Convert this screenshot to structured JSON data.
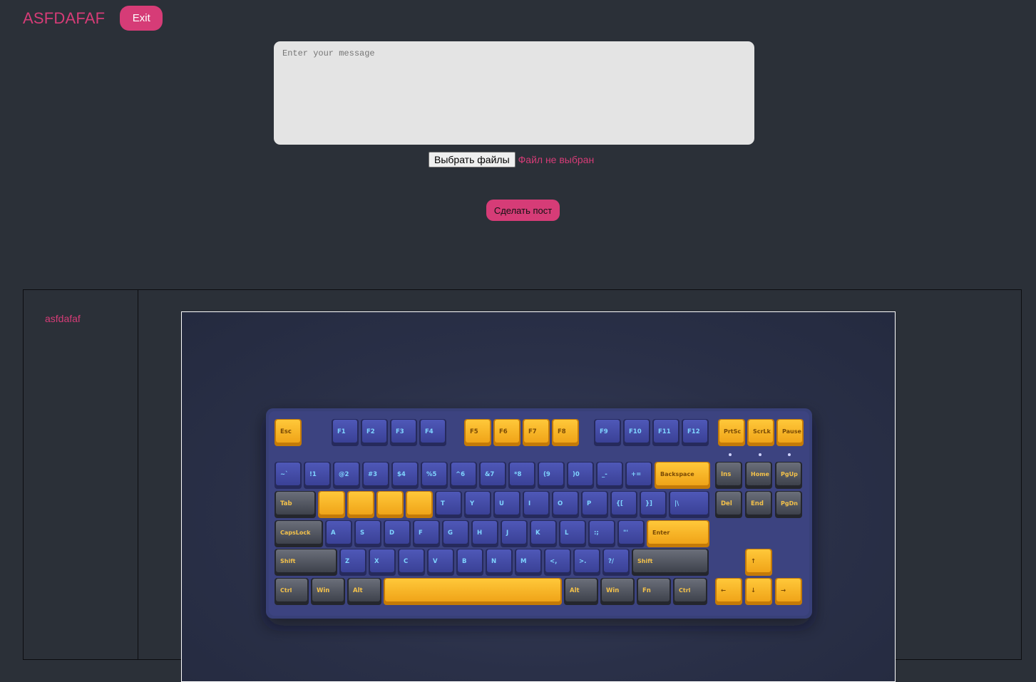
{
  "header": {
    "title": "ASFDAFAF",
    "exit_label": "Exit"
  },
  "composer": {
    "placeholder": "Enter your message",
    "file_button_label": "Выбрать файлы",
    "file_status": "Файл не выбран",
    "submit_label": "Сделать пост"
  },
  "post": {
    "author": "asfdafaf",
    "image_description_icon": "keyboard-photo"
  },
  "colors": {
    "accent": "#d63c77",
    "background": "#2b3038",
    "input_bg": "#e4e4e4"
  },
  "keyboard": {
    "rows": [
      [
        "Esc",
        "F1",
        "F2",
        "F3",
        "F4",
        "F5",
        "F6",
        "F7",
        "F8",
        "F9",
        "F10",
        "F11",
        "F12",
        "PrtSc",
        "ScrLk",
        "Pause"
      ],
      [
        "~`",
        "!1",
        "@2",
        "#3",
        "$4",
        "%5",
        "^6",
        "&7",
        "*8",
        "(9",
        ")0",
        "_-",
        "+=",
        "Backspace",
        "Ins",
        "Home",
        "PgUp"
      ],
      [
        "Tab",
        "",
        "",
        "",
        "",
        "T",
        "Y",
        "U",
        "I",
        "O",
        "P",
        "{[",
        "}]",
        "|\\",
        "Del",
        "End",
        "PgDn"
      ],
      [
        "CapsLock",
        "A",
        "S",
        "D",
        "F",
        "G",
        "H",
        "J",
        "K",
        "L",
        ":;",
        "\"'",
        "Enter"
      ],
      [
        "Shift",
        "Z",
        "X",
        "C",
        "V",
        "B",
        "N",
        "M",
        "<,",
        ">.",
        "?/",
        "Shift",
        "↑"
      ],
      [
        "Ctrl",
        "Win",
        "Alt",
        "",
        "Alt",
        "Win",
        "Fn",
        "Ctrl",
        "←",
        "↓",
        "→"
      ]
    ]
  }
}
